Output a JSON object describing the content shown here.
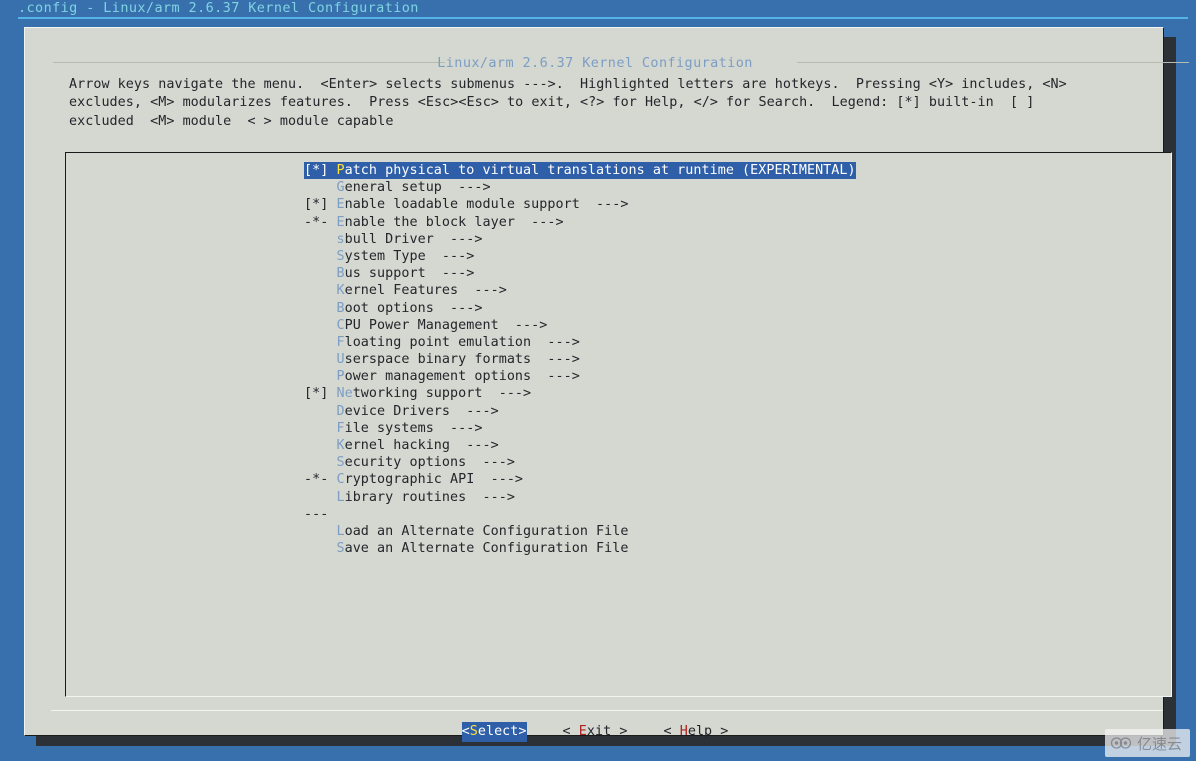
{
  "window": {
    "title": ".config - Linux/arm 2.6.37 Kernel Configuration",
    "title_color": "#7fd4e3"
  },
  "dialog": {
    "title": "Linux/arm 2.6.37 Kernel Configuration",
    "title_color": "#7c9dc4",
    "background": "#d4d8d0",
    "help_text": "Arrow keys navigate the menu.  <Enter> selects submenus --->.  Highlighted letters are hotkeys.  Pressing <Y> includes, <N>\nexcludes, <M> modularizes features.  Press <Esc><Esc> to exit, <?> for Help, </> for Search.  Legend: [*] built-in  [ ]\nexcluded  <M> module  < > module capable"
  },
  "menu": {
    "selected_index": 0,
    "selection_bg": "#2f5fa8",
    "hotkey_color": "#7c9dc4",
    "selected_hotkey_color": "#ffe13b",
    "items": [
      {
        "flag": "[*] ",
        "hotkey": "P",
        "text": "atch physical to virtual translations at runtime (EXPERIMENTAL)",
        "suffix": "",
        "selected": true
      },
      {
        "flag": "    ",
        "hotkey": "G",
        "text": "eneral setup",
        "suffix": "  --->",
        "selected": false
      },
      {
        "flag": "[*] ",
        "hotkey": "E",
        "text": "nable loadable module support",
        "suffix": "  --->",
        "selected": false
      },
      {
        "flag": "-*- ",
        "hotkey": "E",
        "text": "nable the block layer",
        "suffix": "  --->",
        "selected": false
      },
      {
        "flag": "    ",
        "hotkey": "s",
        "text": "bull Driver",
        "suffix": "  --->",
        "selected": false
      },
      {
        "flag": "    ",
        "hotkey": "S",
        "text": "ystem Type",
        "suffix": "  --->",
        "selected": false
      },
      {
        "flag": "    ",
        "hotkey": "B",
        "text": "us support",
        "suffix": "  --->",
        "selected": false
      },
      {
        "flag": "    ",
        "hotkey": "K",
        "text": "ernel Features",
        "suffix": "  --->",
        "selected": false
      },
      {
        "flag": "    ",
        "hotkey": "B",
        "text": "oot options",
        "suffix": "  --->",
        "selected": false
      },
      {
        "flag": "    ",
        "hotkey": "C",
        "text": "PU Power Management",
        "suffix": "  --->",
        "selected": false
      },
      {
        "flag": "    ",
        "hotkey": "F",
        "text": "loating point emulation",
        "suffix": "  --->",
        "selected": false
      },
      {
        "flag": "    ",
        "hotkey": "U",
        "text": "serspace binary formats",
        "suffix": "  --->",
        "selected": false
      },
      {
        "flag": "    ",
        "hotkey": "P",
        "text": "ower management options",
        "suffix": "  --->",
        "selected": false
      },
      {
        "flag": "[*] ",
        "hotkey": "Ne",
        "text": "tworking support",
        "suffix": "  --->",
        "selected": false
      },
      {
        "flag": "    ",
        "hotkey": "D",
        "text": "evice Drivers",
        "suffix": "  --->",
        "selected": false
      },
      {
        "flag": "    ",
        "hotkey": "F",
        "text": "ile systems",
        "suffix": "  --->",
        "selected": false
      },
      {
        "flag": "    ",
        "hotkey": "K",
        "text": "ernel hacking",
        "suffix": "  --->",
        "selected": false
      },
      {
        "flag": "    ",
        "hotkey": "S",
        "text": "ecurity options",
        "suffix": "  --->",
        "selected": false
      },
      {
        "flag": "-*- ",
        "hotkey": "C",
        "text": "ryptographic API",
        "suffix": "  --->",
        "selected": false
      },
      {
        "flag": "    ",
        "hotkey": "L",
        "text": "ibrary routines",
        "suffix": "  --->",
        "selected": false
      },
      {
        "flag": "--- ",
        "hotkey": "",
        "text": "",
        "suffix": "",
        "selected": false
      },
      {
        "flag": "    ",
        "hotkey": "L",
        "text": "oad an Alternate Configuration File",
        "suffix": "",
        "selected": false
      },
      {
        "flag": "    ",
        "hotkey": "S",
        "text": "ave an Alternate Configuration File",
        "suffix": "",
        "selected": false
      }
    ]
  },
  "buttons": [
    {
      "open": "<",
      "hotkey": "S",
      "text": "elect",
      "close": ">",
      "active": true
    },
    {
      "open": "< ",
      "hotkey": "E",
      "text": "xit",
      "close": " >",
      "active": false
    },
    {
      "open": "< ",
      "hotkey": "H",
      "text": "elp",
      "close": " >",
      "active": false
    }
  ],
  "watermark": {
    "text": "亿速云"
  }
}
